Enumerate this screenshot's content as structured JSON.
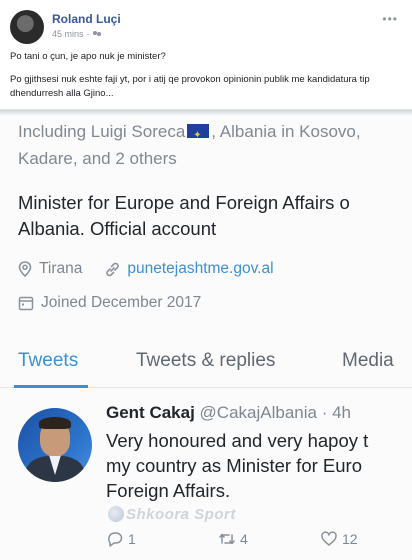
{
  "post": {
    "author": "Roland Luçi",
    "time": "45 mins",
    "separator": "·",
    "more": "•••",
    "text_line1": "Po tani o çun, je apo nuk je minister?",
    "text_line2": "Po gjithsesi nuk eshte faji yt, por i atij qe provokon opinionin publik me kandidatura tip dhendurresh alla Gjino..."
  },
  "profile": {
    "followers_line1_a": "Including Luigi Soreca",
    "followers_line1_b": ", Albania in Kosovo,",
    "followers_line2": "Kadare, and 2 others",
    "bio_line1": "Minister for Europe and Foreign Affairs o",
    "bio_line2": "Albania. Official account",
    "location": "Tirana",
    "website": "punetejashtme.gov.al",
    "joined": "Joined December 2017"
  },
  "tabs": [
    {
      "label": "Tweets",
      "active": true
    },
    {
      "label": "Tweets & replies",
      "active": false
    },
    {
      "label": "Media",
      "active": false
    }
  ],
  "tweet": {
    "name": "Gent Cakaj",
    "handle": "@CakajAlbania · 4h",
    "line1": "Very honoured and very hapoy t",
    "line2": "my country as Minister for Euro",
    "line3": "Foreign Affairs.",
    "replies": "1",
    "retweets": "4",
    "likes": "12"
  },
  "watermark": "Shkoora Sport",
  "colors": {
    "fb_link": "#385898",
    "twitter_blue": "#3d8fd1",
    "muted": "#7e8790"
  },
  "icons": [
    "friends-icon",
    "location-pin-icon",
    "link-icon",
    "calendar-icon",
    "reply-icon",
    "retweet-icon",
    "like-icon",
    "eu-flag-icon"
  ]
}
